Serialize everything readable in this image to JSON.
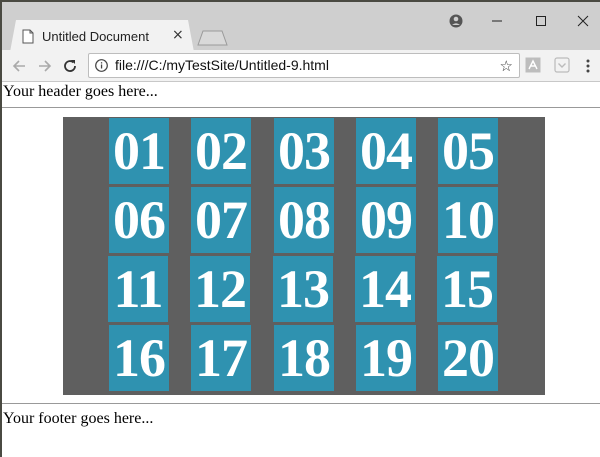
{
  "browser": {
    "tab_title": "Untitled Document",
    "tab_close_glyph": "×",
    "url": "file:///C:/myTestSite/Untitled-9.html",
    "icons": [
      "page-icon",
      "account-icon",
      "minimize-icon",
      "maximize-icon",
      "close-icon",
      "back-arrow-icon",
      "forward-arrow-icon",
      "reload-icon",
      "info-icon",
      "star-icon",
      "pdf-extension-icon",
      "pocket-extension-icon",
      "kebab-menu-icon"
    ]
  },
  "page": {
    "header": "Your header goes here...",
    "footer": "Your footer goes here...",
    "tiles": [
      "01",
      "02",
      "03",
      "04",
      "05",
      "06",
      "07",
      "08",
      "09",
      "10",
      "11",
      "12",
      "13",
      "14",
      "15",
      "16",
      "17",
      "18",
      "19",
      "20"
    ],
    "colors": {
      "gallery_bg": "#5f5f5f",
      "tile_bg": "#2f92b0",
      "tile_text": "#ffffff"
    }
  }
}
